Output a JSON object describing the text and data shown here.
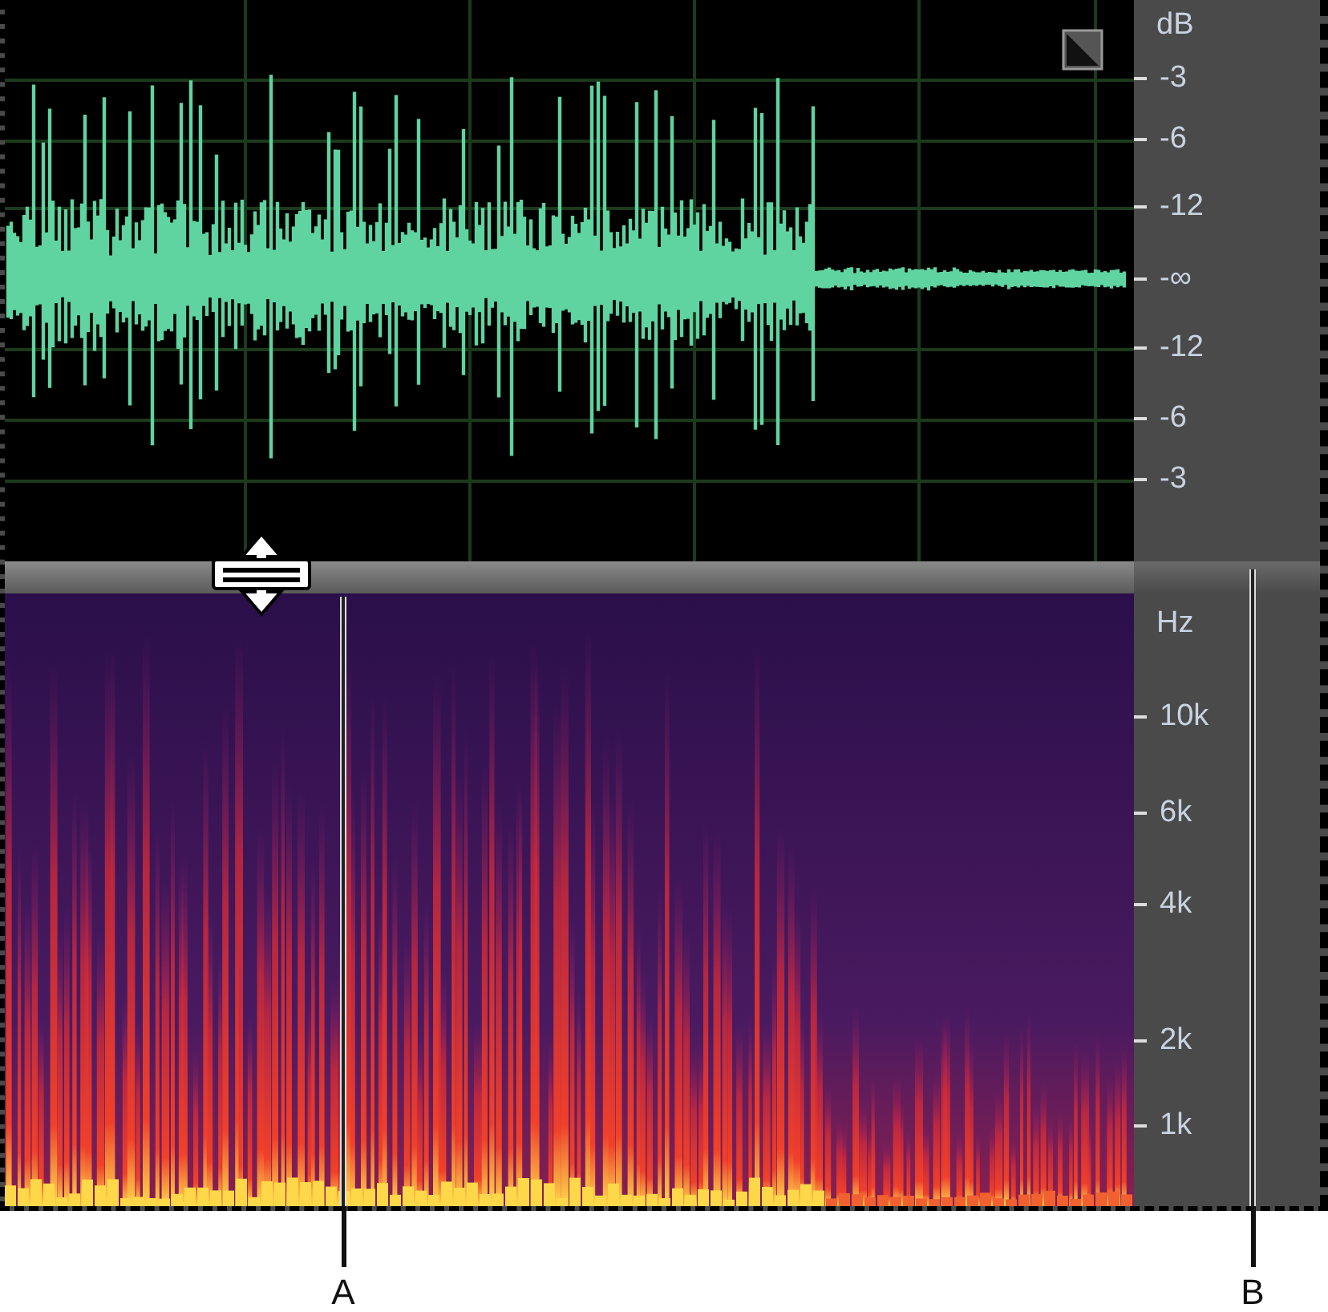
{
  "waveform_panel": {
    "unit": "dB",
    "scale": [
      "-3",
      "-6",
      "-12",
      "-∞",
      "-12",
      "-6",
      "-3"
    ]
  },
  "spectrogram_panel": {
    "unit": "Hz",
    "scale": [
      "10k",
      "6k",
      "4k",
      "2k",
      "1k"
    ]
  },
  "markers": [
    {
      "label": "A"
    },
    {
      "label": "B"
    }
  ]
}
